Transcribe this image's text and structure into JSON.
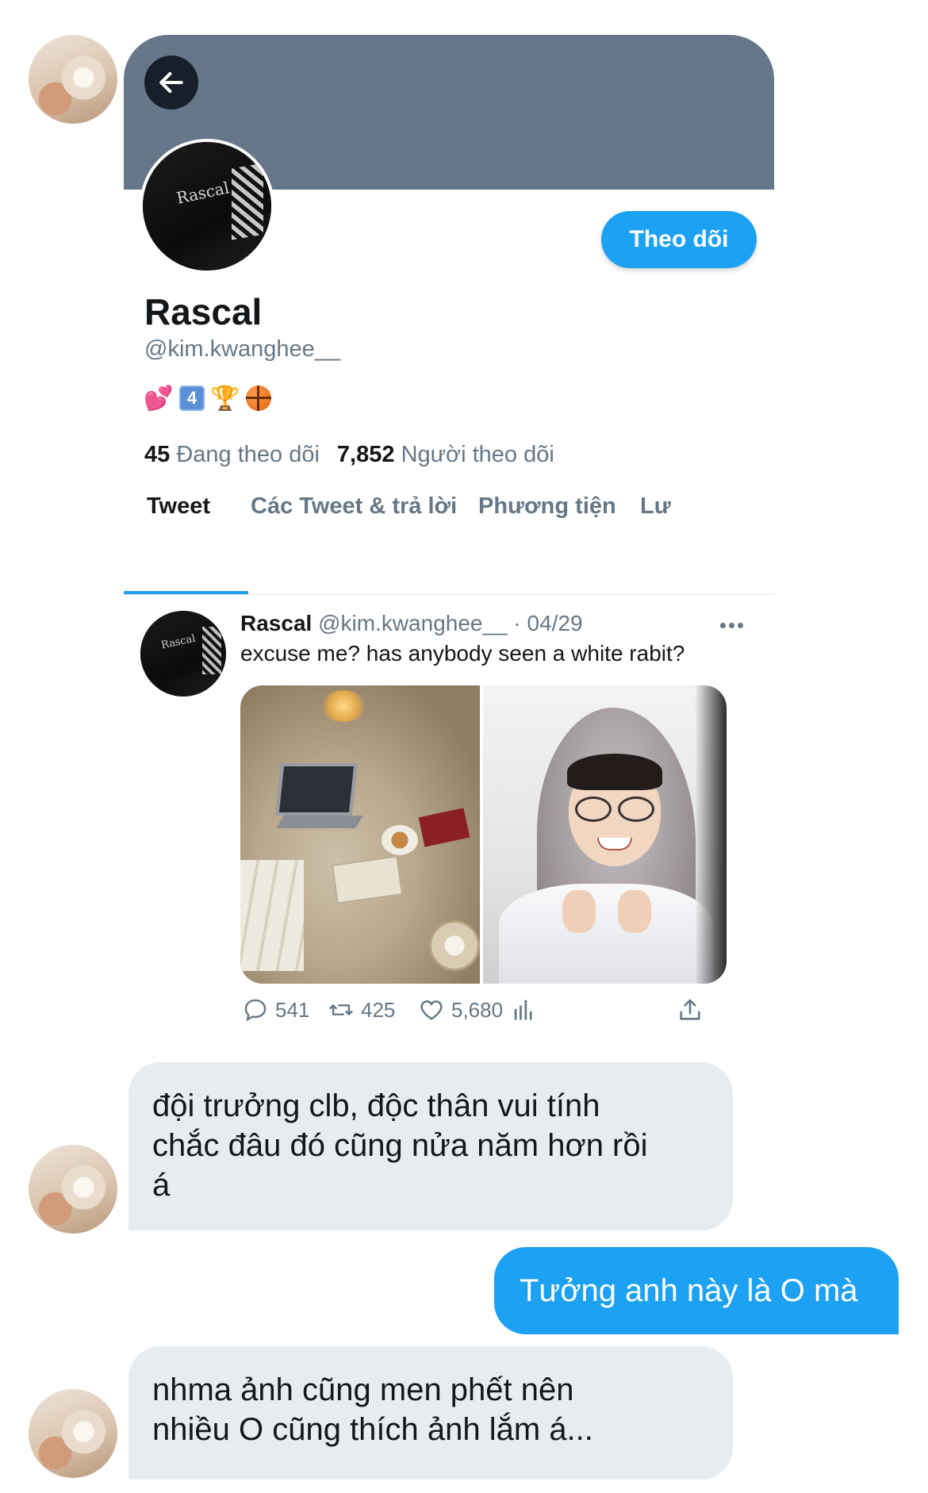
{
  "profile": {
    "back_icon": "arrow-left-icon",
    "follow_label": "Theo dõi",
    "name": "Rascal",
    "handle": "@kim.kwanghee__",
    "bio_emojis": [
      "💕",
      "4",
      "🏆",
      "🏀"
    ],
    "following_count": "45",
    "following_label": "Đang theo dõi",
    "followers_count": "7,852",
    "followers_label": "Người theo dõi",
    "avatar_text": "Rascal"
  },
  "tabs": [
    {
      "label": "Tweet",
      "active": true
    },
    {
      "label": "Các Tweet & trả lời",
      "active": false
    },
    {
      "label": "Phương tiện",
      "active": false
    },
    {
      "label": "Lư",
      "active": false
    }
  ],
  "tweet": {
    "author": "Rascal",
    "handle": "@kim.kwanghee__",
    "separator": "·",
    "date": "04/29",
    "text": "excuse me? has anybody seen a white rabit?",
    "replies": "541",
    "retweets": "425",
    "likes": "5,680",
    "icons": [
      "reply-icon",
      "retweet-icon",
      "like-icon",
      "analytics-icon",
      "share-icon",
      "more-icon"
    ]
  },
  "chat": {
    "messages": [
      {
        "direction": "incoming",
        "lines": [
          "đội trưởng clb, độc thân vui tính",
          "chắc đâu đó cũng nửa năm hơn rồi",
          "á"
        ]
      },
      {
        "direction": "outgoing",
        "lines": [
          "Tưởng anh này là O mà"
        ]
      },
      {
        "direction": "incoming",
        "lines": [
          "nhma ảnh cũng men phết nên",
          "nhiều O cũng thích ảnh lắm á..."
        ]
      }
    ]
  },
  "colors": {
    "banner": "#66778a",
    "accent": "#1da1f2",
    "muted": "#657786",
    "incoming_bubble": "#e7ecf0",
    "outgoing_bubble": "#1da1f2"
  }
}
